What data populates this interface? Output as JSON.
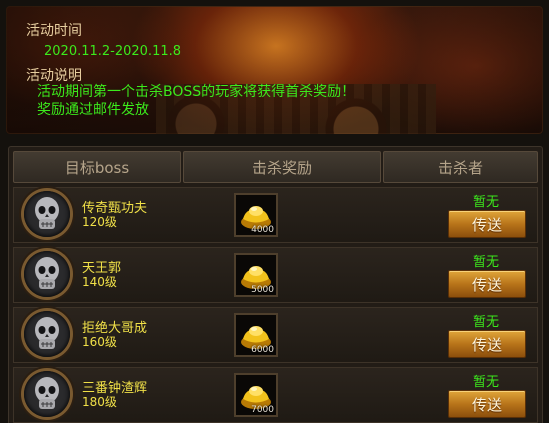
{
  "event": {
    "time_label": "活动时间",
    "time_range": "2020.11.2-2020.11.8",
    "desc_label": "活动说明",
    "desc_line1": "活动期间第一个击杀BOSS的玩家将获得首杀奖励！",
    "desc_line2": "奖励通过邮件发放"
  },
  "table": {
    "headers": [
      "目标boss",
      "击杀奖励",
      "击杀者"
    ],
    "rows": [
      {
        "name": "传奇甄功夫",
        "level": "120级",
        "reward_item": "gold-ingot-icon",
        "reward_count": "4000",
        "killer": "暂无",
        "action": "传送"
      },
      {
        "name": "天王郭",
        "level": "140级",
        "reward_item": "gold-ingot-icon",
        "reward_count": "5000",
        "killer": "暂无",
        "action": "传送"
      },
      {
        "name": "拒绝大哥成",
        "level": "160级",
        "reward_item": "gold-ingot-icon",
        "reward_count": "6000",
        "killer": "暂无",
        "action": "传送"
      },
      {
        "name": "三番钟渣辉",
        "level": "180级",
        "reward_item": "gold-ingot-icon",
        "reward_count": "7000",
        "killer": "暂无",
        "action": "传送"
      }
    ]
  },
  "colors": {
    "highlight_green": "#3cea1c",
    "boss_yellow": "#f0e048",
    "button_orange": "#c8861e"
  }
}
